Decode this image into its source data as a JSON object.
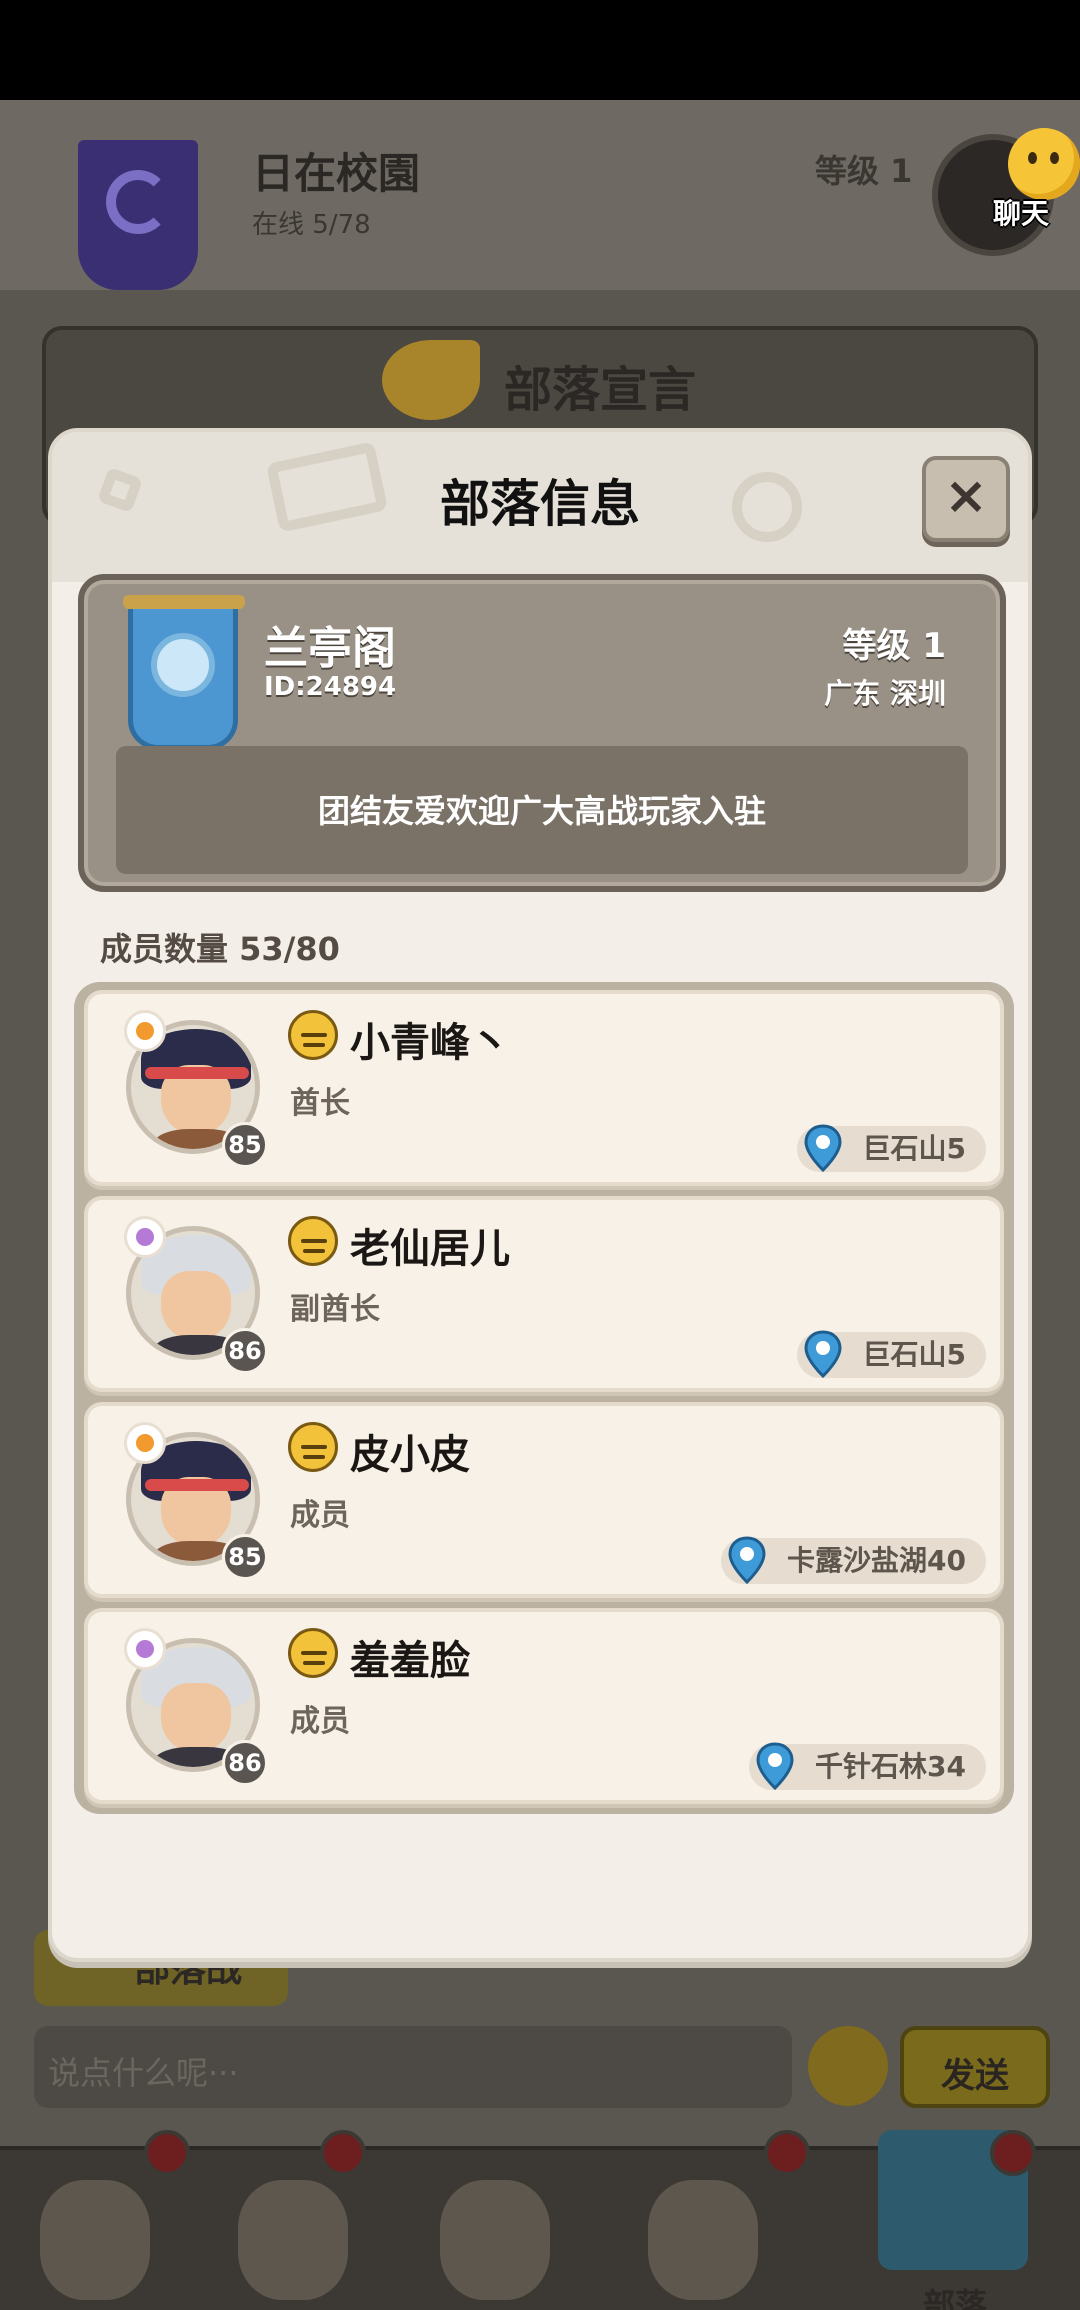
{
  "background": {
    "tribe_title": "日在校園",
    "online": "在线 5/78",
    "level": "等级 1",
    "chat_label": "聊天",
    "declaration_title": "部落宣言",
    "tribe_war_label": "部落战",
    "chat_placeholder": "说点什么呢···",
    "send_label": "发送",
    "nav_tribe_label": "部落"
  },
  "modal": {
    "title": "部落信息",
    "close_label": "×",
    "tribe": {
      "name": "兰亭阁",
      "id": "ID:24894",
      "level": "等级 1",
      "location": "广东 深圳",
      "slogan": "团结友爱欢迎广大高战玩家入驻"
    },
    "member_count": "成员数量 53/80",
    "members": [
      {
        "name": "小青峰丶",
        "role": "酋长",
        "level": "85",
        "location": "巨石山5",
        "avatar": "dark-hair-warrior",
        "class_color": "#f29a2e"
      },
      {
        "name": "老仙居儿",
        "role": "副酋长",
        "level": "86",
        "location": "巨石山5",
        "avatar": "silver-hair-mage",
        "class_color": "#b57ad6"
      },
      {
        "name": "皮小皮",
        "role": "成员",
        "level": "85",
        "location": "卡露沙盐湖40",
        "avatar": "dark-hair-warrior",
        "class_color": "#f29a2e"
      },
      {
        "name": "羞羞脸",
        "role": "成员",
        "level": "86",
        "location": "千针石林34",
        "avatar": "silver-hair-mage",
        "class_color": "#b57ad6"
      }
    ]
  },
  "colors": {
    "modal_bg": "#f3efe8",
    "card_bg": "#9a9186",
    "pin_blue": "#3f9ad8",
    "emoji_yellow": "#f2c23a"
  }
}
